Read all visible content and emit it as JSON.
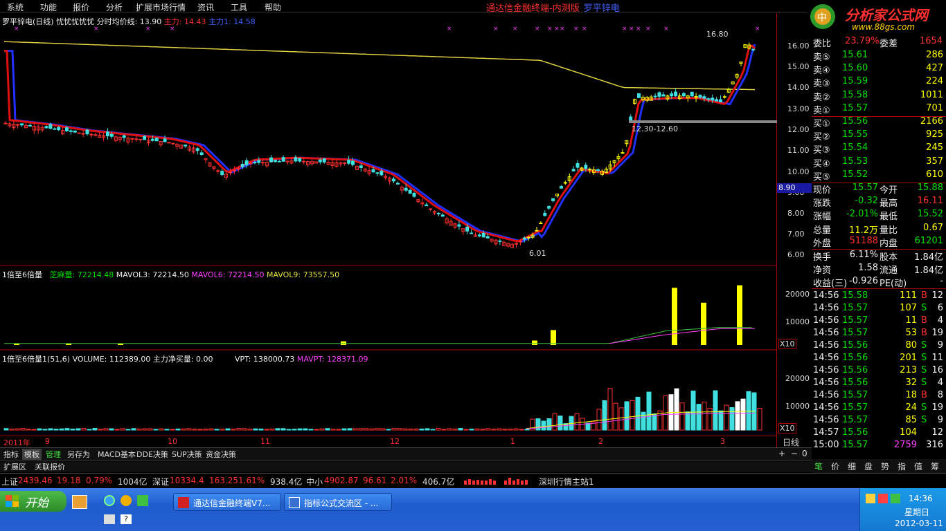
{
  "menu": [
    "系统",
    "功能",
    "报价",
    "分析",
    "扩展市场行情",
    "资讯",
    "工具",
    "帮助"
  ],
  "title": {
    "app": "通达信金融终端-内测版",
    "stock": "罗平锌电"
  },
  "logo": {
    "text": "分析家公式网",
    "url": "www.88gs.com"
  },
  "chart_header": {
    "name": "罗平锌电(日线)",
    "tags": "忧忧忧忧忧",
    "avg": "分时均价线: 13.90",
    "main": "主力: 14.43",
    "main1": "主力1: 14.58"
  },
  "price_labels": {
    "high": "16.80",
    "low": "6.01",
    "range": "12.30-12.60",
    "cursor": "8.90"
  },
  "price_axis": [
    "16.00",
    "15.00",
    "14.00",
    "13.00",
    "12.00",
    "11.00",
    "10.00",
    "9.00",
    "8.00",
    "7.00",
    "6.00"
  ],
  "vol_header": {
    "name": "1倍至6倍量",
    "vol": "芝麻量: 72214.48",
    "ma3": "MAVOL3: 72214.50",
    "ma6": "MAVOL6: 72214.50",
    "ma9": "MAVOL9: 73557.50"
  },
  "vol_axis": [
    "20000",
    "10000",
    "X10"
  ],
  "vol2_header": {
    "name": "1倍至6倍量1(51,6)",
    "vol": "VOLUME: 112389.00",
    "net": "主力净买量: 0.00",
    "vpt": "VPT: 138000.73",
    "mavpt": "MAVPT: 128371.09"
  },
  "vol2_axis": [
    "20000",
    "10000",
    "X10"
  ],
  "time_axis": [
    "2011年",
    "9",
    "10",
    "11",
    "12",
    "1",
    "2",
    "3"
  ],
  "period": "日线",
  "quote": {
    "top": {
      "l1": "委比",
      "v1": "23.79%",
      "l2": "委差",
      "v2": "1654"
    },
    "sell": [
      {
        "l": "卖⑤",
        "p": "15.61",
        "v": "286"
      },
      {
        "l": "卖④",
        "p": "15.60",
        "v": "427"
      },
      {
        "l": "卖③",
        "p": "15.59",
        "v": "224"
      },
      {
        "l": "卖②",
        "p": "15.58",
        "v": "1011"
      },
      {
        "l": "卖①",
        "p": "15.57",
        "v": "701"
      }
    ],
    "buy": [
      {
        "l": "买①",
        "p": "15.56",
        "v": "2166"
      },
      {
        "l": "买②",
        "p": "15.55",
        "v": "925"
      },
      {
        "l": "买③",
        "p": "15.54",
        "v": "245"
      },
      {
        "l": "买④",
        "p": "15.53",
        "v": "357"
      },
      {
        "l": "买⑤",
        "p": "15.52",
        "v": "610"
      }
    ],
    "info": [
      {
        "a": "现价",
        "b": "15.57",
        "c": "今开",
        "d": "15.88"
      },
      {
        "a": "涨跌",
        "b": "-0.32",
        "c": "最高",
        "d": "16.11"
      },
      {
        "a": "涨幅",
        "b": "-2.01%",
        "c": "最低",
        "d": "15.52"
      },
      {
        "a": "总量",
        "b": "11.2万",
        "c": "量比",
        "d": "0.67"
      },
      {
        "a": "外盘",
        "b": "51188",
        "c": "内盘",
        "d": "61201"
      },
      {
        "a": "换手",
        "b": "6.11%",
        "c": "股本",
        "d": "1.84亿"
      },
      {
        "a": "净资",
        "b": "1.58",
        "c": "流通",
        "d": "1.84亿"
      },
      {
        "a": "收益(三)",
        "b": "-0.926",
        "c": "PE(动)",
        "d": "-"
      }
    ],
    "ticks": [
      {
        "t": "14:56",
        "p": "15.58",
        "v": "111",
        "d": "B",
        "n": "12"
      },
      {
        "t": "14:56",
        "p": "15.57",
        "v": "107",
        "d": "S",
        "n": "6"
      },
      {
        "t": "14:56",
        "p": "15.57",
        "v": "11",
        "d": "B",
        "n": "4"
      },
      {
        "t": "14:56",
        "p": "15.57",
        "v": "53",
        "d": "B",
        "n": "19"
      },
      {
        "t": "14:56",
        "p": "15.56",
        "v": "80",
        "d": "S",
        "n": "9"
      },
      {
        "t": "14:56",
        "p": "15.56",
        "v": "201",
        "d": "S",
        "n": "11"
      },
      {
        "t": "14:56",
        "p": "15.56",
        "v": "213",
        "d": "S",
        "n": "16"
      },
      {
        "t": "14:56",
        "p": "15.56",
        "v": "32",
        "d": "S",
        "n": "4"
      },
      {
        "t": "14:56",
        "p": "15.57",
        "v": "18",
        "d": "B",
        "n": "8"
      },
      {
        "t": "14:56",
        "p": "15.57",
        "v": "24",
        "d": "S",
        "n": "19"
      },
      {
        "t": "14:56",
        "p": "15.57",
        "v": "85",
        "d": "S",
        "n": "9"
      },
      {
        "t": "14:57",
        "p": "15.56",
        "v": "104",
        "d": "",
        "n": "12"
      },
      {
        "t": "15:00",
        "p": "15.57",
        "v": "2759",
        "d": "",
        "n": "316"
      }
    ]
  },
  "bottom_tabs": [
    "指标",
    "模板",
    "管理",
    "另存为",
    "MACD基本",
    "DDE决策",
    "SUP决策",
    "资金决策"
  ],
  "tabs2": [
    "扩展区",
    "关联报价"
  ],
  "right_tabs": [
    "笔",
    "价",
    "细",
    "盘",
    "势",
    "指",
    "值",
    "筹"
  ],
  "status": {
    "sh": {
      "l": "上证",
      "v": "2439.46",
      "c": "19.18",
      "p": "0.79%",
      "a": "1004亿"
    },
    "sz": {
      "l": "深证",
      "v": "10334.4",
      "c": "163.25",
      "p": "1.61%",
      "a": "938.4亿"
    },
    "zx": {
      "l": "中小",
      "v": "4902.87",
      "c": "96.61",
      "p": "2.01%",
      "a": "406.7亿"
    },
    "server": "深圳行情主站1"
  },
  "taskbar": {
    "start": "开始",
    "t1": "通达信金融终端V7...",
    "t2": "指标公式交流区 - ...",
    "time": "14:36",
    "weekday": "星期日",
    "date": "2012-03-11"
  }
}
